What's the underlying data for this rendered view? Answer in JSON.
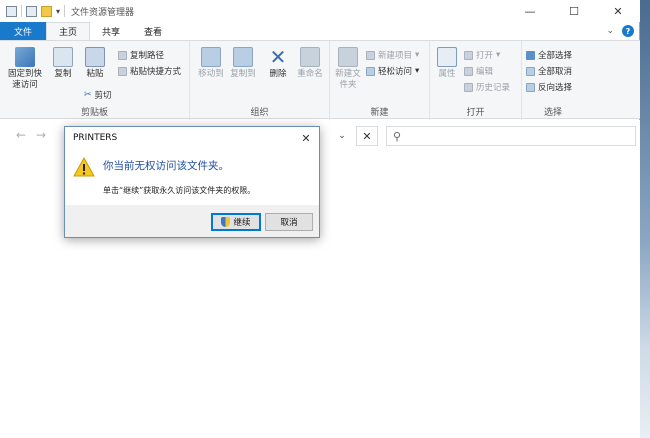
{
  "window": {
    "title": "文件资源管理器",
    "controls": {
      "minimize": "—",
      "maximize": "☐",
      "close": "✕"
    }
  },
  "tabs": {
    "file": "文件",
    "home": "主页",
    "share": "共享",
    "view": "查看",
    "help": "?"
  },
  "ribbon": {
    "clipboard": {
      "label": "剪贴板",
      "pin": "固定到快速访问",
      "copy": "复制",
      "paste": "粘贴",
      "copy_path": "复制路径",
      "paste_shortcut": "粘贴快捷方式",
      "cut": "剪切"
    },
    "organize": {
      "label": "组织",
      "move_to": "移动到",
      "copy_to": "复制到",
      "delete": "删除",
      "rename": "重命名"
    },
    "new": {
      "label": "新建",
      "new_folder": "新建文件夹",
      "new_item": "新建项目",
      "easy_access": "轻松访问"
    },
    "open": {
      "label": "打开",
      "properties": "属性",
      "open": "打开",
      "edit": "编辑",
      "history": "历史记录"
    },
    "select": {
      "label": "选择",
      "select_all": "全部选择",
      "select_none": "全部取消",
      "invert": "反向选择"
    }
  },
  "dialog": {
    "title": "PRINTERS",
    "message": "你当前无权访问该文件夹。",
    "detail": "单击“继续”获取永久访问该文件夹的权限。",
    "continue": "继续",
    "cancel": "取消",
    "close": "✕"
  }
}
